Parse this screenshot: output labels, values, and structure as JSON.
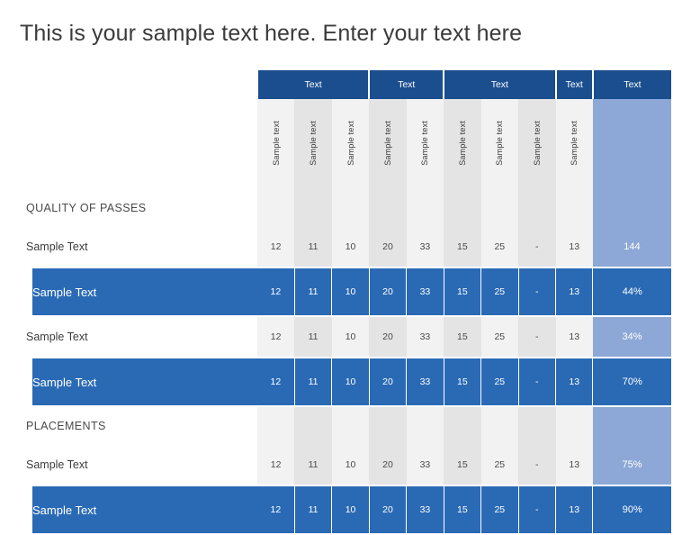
{
  "slide": {
    "title": "This is your sample text here. Enter your text here"
  },
  "colors": {
    "header_blue": "#1a4e8f",
    "row_blue": "#2a6ab5",
    "total_blue": "#8da7d6",
    "stripe_light": "#f2f2f2",
    "stripe_dark": "#e4e4e4"
  },
  "table": {
    "column_groups": [
      {
        "label": "Text",
        "span": 3
      },
      {
        "label": "Text",
        "span": 2
      },
      {
        "label": "Text",
        "span": 3
      },
      {
        "label": "Text",
        "span": 1
      },
      {
        "label": "Text",
        "span": 1
      }
    ],
    "sub_headers": [
      "Sample text",
      "Sample text",
      "Sample text",
      "Sample text",
      "Sample text",
      "Sample text",
      "Sample text",
      "Sample text",
      "Sample text"
    ],
    "rows": [
      {
        "kind": "section",
        "label": "QUALITY OF PASSES",
        "values": [
          "",
          "",
          "",
          "",
          "",
          "",
          "",
          "",
          ""
        ],
        "total": ""
      },
      {
        "kind": "plain",
        "label": "Sample Text",
        "values": [
          "12",
          "11",
          "10",
          "20",
          "33",
          "15",
          "25",
          "-",
          "13"
        ],
        "total": "144"
      },
      {
        "kind": "highlight",
        "label": "Sample Text",
        "values": [
          "12",
          "11",
          "10",
          "20",
          "33",
          "15",
          "25",
          "-",
          "13"
        ],
        "total": "44%"
      },
      {
        "kind": "plain",
        "label": "Sample Text",
        "values": [
          "12",
          "11",
          "10",
          "20",
          "33",
          "15",
          "25",
          "-",
          "13"
        ],
        "total": "34%"
      },
      {
        "kind": "highlight",
        "label": "Sample Text",
        "values": [
          "12",
          "11",
          "10",
          "20",
          "33",
          "15",
          "25",
          "-",
          "13"
        ],
        "total": "70%"
      },
      {
        "kind": "section",
        "label": "PLACEMENTS",
        "values": [
          "",
          "",
          "",
          "",
          "",
          "",
          "",
          "",
          ""
        ],
        "total": ""
      },
      {
        "kind": "plain",
        "label": "Sample Text",
        "values": [
          "12",
          "11",
          "10",
          "20",
          "33",
          "15",
          "25",
          "-",
          "13"
        ],
        "total": "75%"
      },
      {
        "kind": "highlight",
        "label": "Sample Text",
        "values": [
          "12",
          "11",
          "10",
          "20",
          "33",
          "15",
          "25",
          "-",
          "13"
        ],
        "total": "90%"
      }
    ]
  }
}
